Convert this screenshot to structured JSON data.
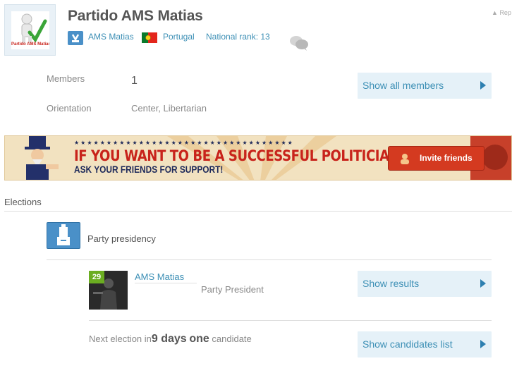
{
  "header": {
    "party_name": "Partido AMS Matias",
    "logo_text": "Partido AMS Matias",
    "report_label": "Rep",
    "leader_name": "AMS Matias",
    "country": "Portugal",
    "national_rank": "National rank: 13"
  },
  "info": {
    "members_label": "Members",
    "members_value": "1",
    "orientation_label": "Orientation",
    "orientation_value": "Center, Libertarian",
    "show_members_button": "Show all members"
  },
  "banner": {
    "headline": "IF YOU WANT TO BE A SUCCESSFUL POLITICIAN",
    "subline": "ASK YOUR FRIENDS FOR SUPPORT!",
    "invite_button": "Invite friends"
  },
  "elections": {
    "section_title": "Elections",
    "presidency_label": "Party presidency",
    "candidate": {
      "level": "29",
      "name": "AMS Matias",
      "role": "Party President"
    },
    "show_results_button": "Show results",
    "next_election_prefix": "Next election in",
    "next_election_days": "9 days",
    "next_election_count": "one",
    "next_election_suffix": " candidate",
    "show_candidates_button": "Show candidates list"
  },
  "colors": {
    "link": "#3c8fb5",
    "button_bg": "#e5f1f8",
    "banner_red": "#c8231b",
    "invite_button": "#d43a20",
    "level_badge": "#6bad21"
  }
}
